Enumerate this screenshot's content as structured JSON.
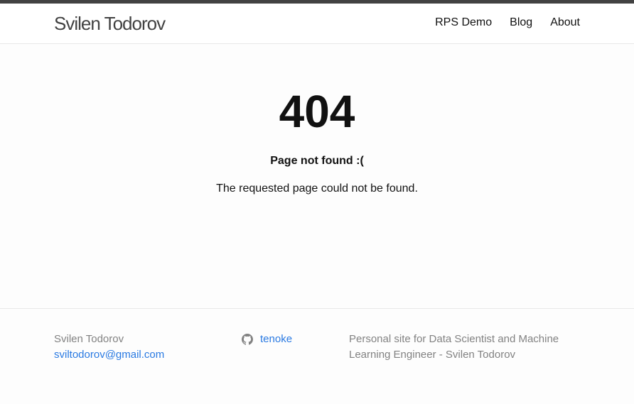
{
  "header": {
    "site_title": "Svilen Todorov",
    "nav": [
      {
        "label": "RPS Demo"
      },
      {
        "label": "Blog"
      },
      {
        "label": "About"
      }
    ]
  },
  "main": {
    "error_code": "404",
    "error_title": "Page not found :(",
    "error_message": "The requested page could not be found."
  },
  "footer": {
    "name": "Svilen Todorov",
    "email": "sviltodorov@gmail.com",
    "github_username": "tenoke",
    "github_icon": "github-icon",
    "description": "Personal site for Data Scientist and Machine Learning Engineer - Svilen Todorov"
  },
  "colors": {
    "top_stripe": "#424242",
    "link": "#2a7ae2",
    "muted_text": "#828282",
    "background": "#fdfdfd"
  }
}
